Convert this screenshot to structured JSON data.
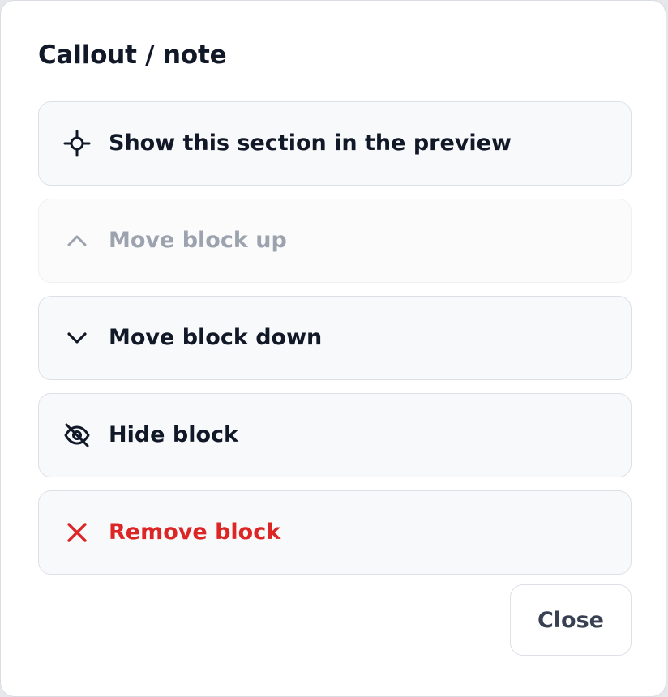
{
  "dialog": {
    "title": "Callout / note"
  },
  "actions": [
    {
      "label": "Show this section in the preview",
      "icon": "crosshair-icon",
      "state": "enabled"
    },
    {
      "label": "Move block up",
      "icon": "chevron-up-icon",
      "state": "disabled"
    },
    {
      "label": "Move block down",
      "icon": "chevron-down-icon",
      "state": "enabled"
    },
    {
      "label": "Hide block",
      "icon": "eye-off-icon",
      "state": "enabled"
    },
    {
      "label": "Remove block",
      "icon": "close-icon",
      "state": "danger"
    }
  ],
  "footer": {
    "close_label": "Close"
  },
  "colors": {
    "text": "#111827",
    "disabled": "#9ca3af",
    "danger": "#dc2626",
    "button_bg": "#f8f9fb",
    "border": "#dde1e7"
  }
}
